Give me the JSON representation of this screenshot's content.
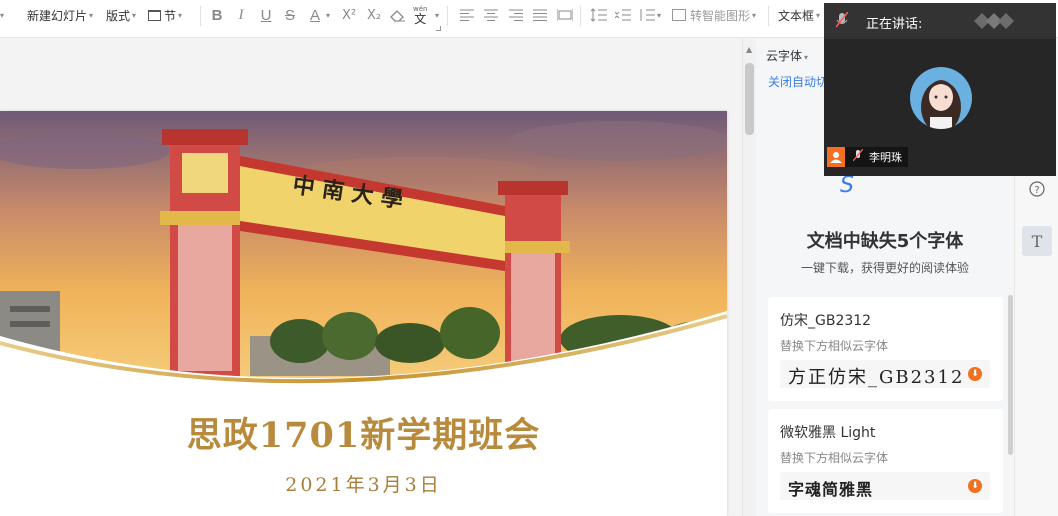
{
  "toolbar": {
    "new_slide": "新建幻灯片",
    "layout": "版式",
    "section": "节",
    "bold": "B",
    "italic": "I",
    "underline": "U",
    "strike": "S",
    "font_color": "A",
    "superscript": "X²",
    "subscript": "X₂",
    "phonetic": "wén",
    "smart_graphic": "转智能图形",
    "textbox": "文本框"
  },
  "slide": {
    "title": "思政1701新学期班会",
    "date": "2021年3月3日",
    "gate_text": "中 南 大 學"
  },
  "panel": {
    "cloud_font": "云字体",
    "close_link": "关闭自动切",
    "logo": "S",
    "missing_title": "文档中缺失5个字体",
    "missing_sub": "一键下载，获得更好的阅读体验",
    "fonts": [
      {
        "name": "仿宋_GB2312",
        "hint": "替换下方相似云字体",
        "sample": "方正仿宋_GB2312"
      },
      {
        "name": "微软雅黑 Light",
        "hint": "替换下方相似云字体",
        "sample": "字魂简雅黑"
      }
    ]
  },
  "meeting": {
    "speaking_label": "正在讲话:",
    "participant": "李明珠"
  },
  "colors": {
    "title_gold": "#b88a3c",
    "link_blue": "#3b7de9",
    "download_orange": "#f36f21",
    "meeting_bg": "#262626"
  }
}
